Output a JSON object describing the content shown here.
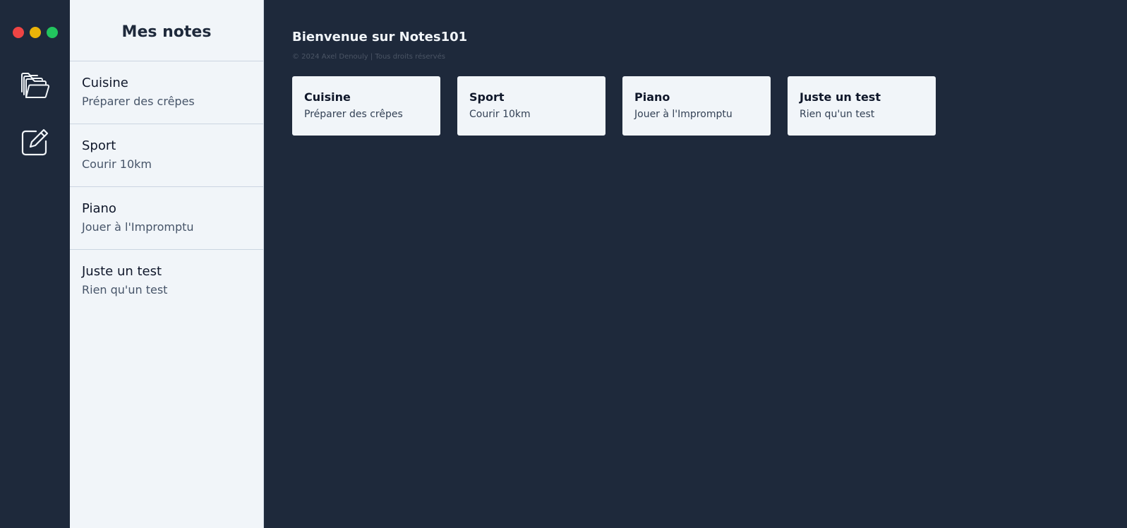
{
  "window": {
    "controls": [
      {
        "name": "close",
        "color": "#ef4444"
      },
      {
        "name": "minimize",
        "color": "#eab308"
      },
      {
        "name": "maximize",
        "color": "#22c55e"
      }
    ]
  },
  "rail": {
    "items": [
      {
        "icon": "folders-icon"
      },
      {
        "icon": "edit-note-icon"
      }
    ]
  },
  "sidebar": {
    "title": "Mes notes",
    "notes": [
      {
        "title": "Cuisine",
        "description": "Préparer des crêpes"
      },
      {
        "title": "Sport",
        "description": "Courir 10km"
      },
      {
        "title": "Piano",
        "description": "Jouer à l'Impromptu"
      },
      {
        "title": "Juste un test",
        "description": "Rien qu'un test"
      }
    ]
  },
  "main": {
    "welcome": "Bienvenue sur Notes101",
    "copyright": "© 2024 Axel Denouly | Tous droits réservés",
    "cards": [
      {
        "title": "Cuisine",
        "description": "Préparer des crêpes"
      },
      {
        "title": "Sport",
        "description": "Courir 10km"
      },
      {
        "title": "Piano",
        "description": "Jouer à l'Impromptu"
      },
      {
        "title": "Juste un test",
        "description": "Rien qu'un test"
      }
    ]
  },
  "colors": {
    "background_dark": "#1e293b",
    "sidebar_background": "#f1f5f9",
    "card_background": "#f1f5f9",
    "divider": "#cbd5e1"
  }
}
